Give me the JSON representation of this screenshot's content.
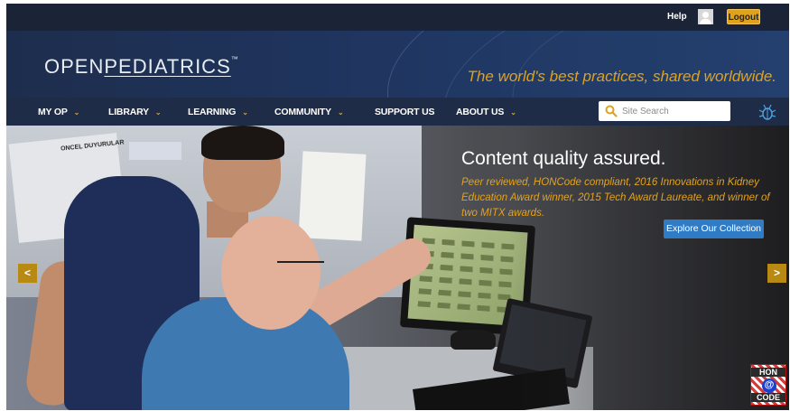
{
  "topbar": {
    "help_label": "Help",
    "logout_label": "Logout"
  },
  "header": {
    "logo": {
      "part1": "OPEN",
      "part2": "PEDIATRICS",
      "tm": "™"
    },
    "tagline": "The world's best practices, shared worldwide."
  },
  "nav": {
    "items": [
      {
        "label": "MY OP",
        "has_dropdown": true
      },
      {
        "label": "LIBRARY",
        "has_dropdown": true
      },
      {
        "label": "LEARNING",
        "has_dropdown": true
      },
      {
        "label": "COMMUNITY",
        "has_dropdown": true
      },
      {
        "label": "SUPPORT US",
        "has_dropdown": false
      },
      {
        "label": "ABOUT US",
        "has_dropdown": true
      }
    ],
    "caret": "⌄",
    "search": {
      "placeholder": "Site Search",
      "value": ""
    },
    "icons": {
      "search": "search-icon",
      "bug": "bug-icon"
    }
  },
  "hero": {
    "title": "Content quality assured.",
    "description": "Peer reviewed, HONCode compliant, 2016 Innovations in Kidney Education Award winner, 2015 Tech Award Laureate, and winner of two MITX awards.",
    "cta_label": "Explore Our Collection",
    "prev_label": "<",
    "next_label": ">",
    "board_text": "ONCEL DUYURULAR",
    "badge": {
      "line1": "HON",
      "line2": "@",
      "line3": "CODE"
    }
  },
  "colors": {
    "accent": "#e0a21a",
    "nav_bg": "#1f2c47",
    "topbar_bg": "#1b2436",
    "button_blue": "#2f7bc6"
  }
}
